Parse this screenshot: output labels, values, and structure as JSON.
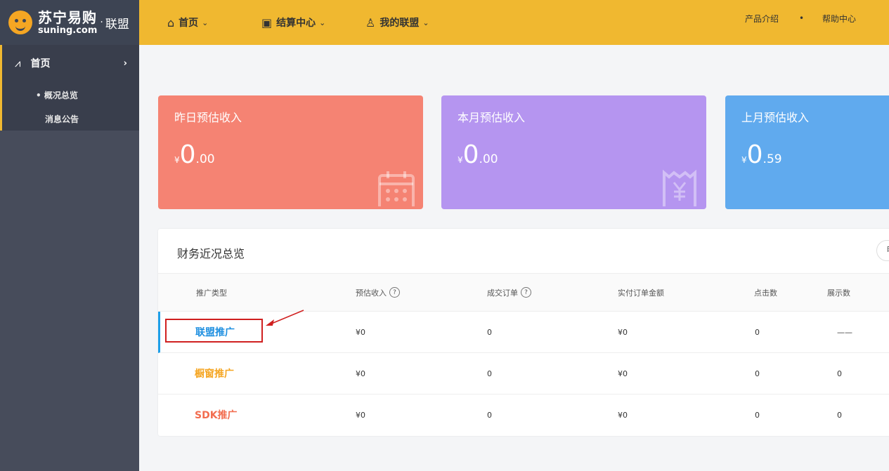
{
  "brand": {
    "name_cn": "苏宁易购",
    "name_en": "suning.com",
    "dot": "·",
    "union": "联盟"
  },
  "nav": {
    "items": [
      {
        "label": "首页",
        "icon": "home-icon"
      },
      {
        "label": "结算中心",
        "icon": "settlement-icon"
      },
      {
        "label": "我的联盟",
        "icon": "user-icon"
      }
    ],
    "links": [
      "产品介绍",
      "帮助中心"
    ],
    "separator": "•"
  },
  "sidebar": {
    "home": "首页",
    "sub_items": [
      "概况总览",
      "消息公告"
    ],
    "active_bullet": "•"
  },
  "cards": [
    {
      "title": "昨日预估收入",
      "currency": "¥",
      "int": "0",
      "dec": ".00",
      "color": "#f58373"
    },
    {
      "title": "本月预估收入",
      "currency": "¥",
      "int": "0",
      "dec": ".00",
      "color": "#b595f0"
    },
    {
      "title": "上月预估收入",
      "currency": "¥",
      "int": "0",
      "dec": ".59",
      "color": "#60aaee"
    }
  ],
  "finance": {
    "title": "财务近况总览",
    "button_label": "时",
    "columns": [
      "推广类型",
      "预估收入",
      "成交订单",
      "实付订单金额",
      "点击数",
      "展示数"
    ],
    "help_glyph": "?",
    "rows": [
      {
        "type": "联盟推广",
        "income": "¥0",
        "orders": "0",
        "paid": "¥0",
        "clicks": "0",
        "views": "——",
        "color": "#1e8fe0"
      },
      {
        "type": "橱窗推广",
        "income": "¥0",
        "orders": "0",
        "paid": "¥0",
        "clicks": "0",
        "views": "0",
        "color": "#f5a623"
      },
      {
        "type": "SDK推广",
        "income": "¥0",
        "orders": "0",
        "paid": "¥0",
        "clicks": "0",
        "views": "0",
        "color": "#f26d4f"
      }
    ]
  }
}
